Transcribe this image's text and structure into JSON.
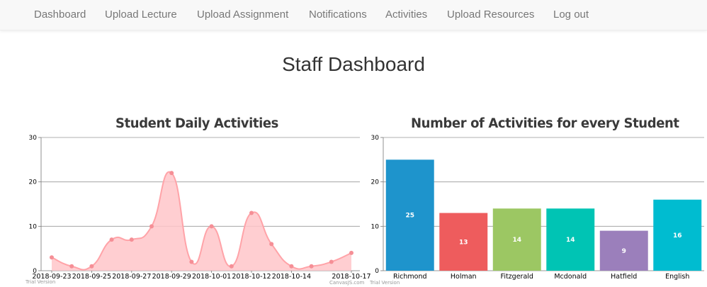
{
  "nav": {
    "items": [
      {
        "label": "Dashboard"
      },
      {
        "label": "Upload Lecture"
      },
      {
        "label": "Upload Assignment"
      },
      {
        "label": "Notifications"
      },
      {
        "label": "Activities"
      },
      {
        "label": "Upload Resources"
      },
      {
        "label": "Log out"
      }
    ]
  },
  "page": {
    "title": "Staff Dashboard"
  },
  "charts": {
    "watermark": "Trial Version",
    "credit": "CanvasJS.com"
  },
  "chart_data": [
    {
      "type": "area",
      "title": "Student Daily Activities",
      "x": [
        "2018-09-23",
        "2018-09-24",
        "2018-09-25",
        "2018-09-26",
        "2018-09-27",
        "2018-09-28",
        "2018-09-29",
        "2018-09-30",
        "2018-10-01",
        "2018-10-11",
        "2018-10-12",
        "2018-10-13",
        "2018-10-14",
        "2018-10-15",
        "2018-10-16",
        "2018-10-17"
      ],
      "x_tick_labels": [
        "2018-09-23",
        "2018-09-25",
        "2018-09-27",
        "2018-09-29",
        "2018-10-01",
        "2018-10-12",
        "2018-10-14",
        "2018-10-17"
      ],
      "series": [
        {
          "values": [
            3,
            1,
            1,
            7,
            7,
            10,
            22,
            2,
            10,
            1,
            13,
            6,
            1,
            1,
            2,
            4
          ]
        }
      ],
      "ylim": [
        0,
        30
      ],
      "y_ticks": [
        0,
        10,
        20,
        30
      ],
      "grid": true,
      "colors": {
        "fill": "#ffc6c9",
        "line": "#ffa3a8",
        "marker": "#f58f96"
      }
    },
    {
      "type": "bar",
      "title": "Number of Activities for every Student",
      "categories": [
        "Richmond",
        "Holman",
        "Fitzgerald",
        "Mcdonald",
        "Hatfield",
        "English"
      ],
      "values": [
        25,
        13,
        14,
        14,
        9,
        16
      ],
      "ylim": [
        0,
        30
      ],
      "y_ticks": [
        0,
        10,
        20,
        30
      ],
      "grid": true,
      "colors": [
        "#1e94cc",
        "#ee5c5d",
        "#9cc763",
        "#00c4b4",
        "#9b7fbb",
        "#00bcd0"
      ]
    }
  ]
}
